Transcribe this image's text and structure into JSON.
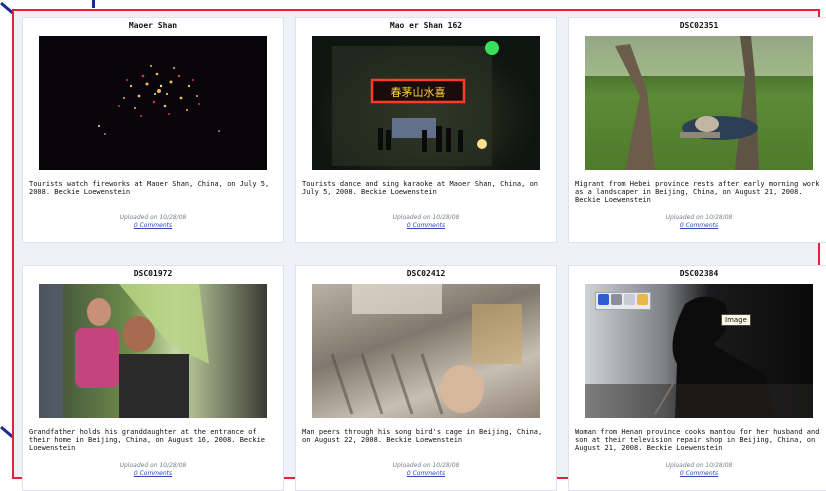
{
  "photos": [
    {
      "title": "Maoer Shan",
      "caption": "Tourists watch fireworks at Maoer Shan, China, on July 5, 2008. Beckie Loewenstein",
      "uploaded": "Uploaded on 10/28/08",
      "comments": "0 Comments"
    },
    {
      "title": "Mao er Shan 162",
      "caption": "Tourists dance and sing karaoke at Maoer Shan, China, on July 5, 2008. Beckie Loewenstein",
      "uploaded": "Uploaded on 10/28/08",
      "comments": "0 Comments"
    },
    {
      "title": "DSC02351",
      "caption": "Migrant from Hebei province rests after early morning work as a landscaper in Beijing, China, on August 21, 2008. Beckie Loewenstein",
      "uploaded": "Uploaded on 10/28/08",
      "comments": "0 Comments"
    },
    {
      "title": "DSC01972",
      "caption": "Grandfather holds his granddaughter at the entrance of their home in Beijing, China, on August 16, 2008. Beckie Loewenstein",
      "uploaded": "Uploaded on 10/28/08",
      "comments": "0 Comments"
    },
    {
      "title": "DSC02412",
      "caption": "Man peers through his song bird's cage in Beijing, China, on August 22, 2008. Beckie Loewenstein",
      "uploaded": "Uploaded on 10/28/08",
      "comments": "0 Comments"
    },
    {
      "title": "DSC02384",
      "caption": "Woman from Henan province cooks mantou for her husband and son at their television repair shop in Beijing, China, on August 21, 2008. Beckie Loewenstein",
      "uploaded": "Uploaded on 10/28/08",
      "comments": "0 Comments"
    }
  ],
  "karaoke_sign": "春茅山水喜",
  "image_toolbar": {
    "tooltip": "Image",
    "icons": [
      "save-icon",
      "print-icon",
      "email-icon",
      "folder-icon"
    ]
  }
}
